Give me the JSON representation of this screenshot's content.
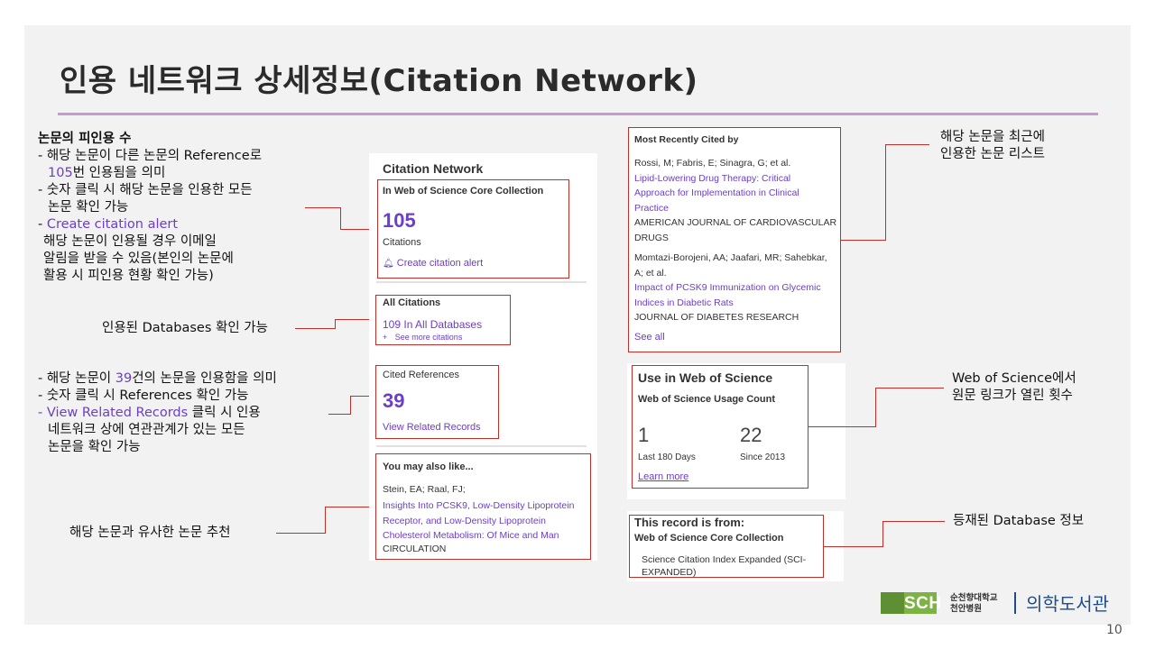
{
  "slide": {
    "title": "인용 네트워크 상세정보(Citation Network)",
    "page_number": "10"
  },
  "left_annotations": {
    "times_cited": {
      "heading": "논문의 피인용 수",
      "line1": "- 해당 논문이 다른 논문의 Reference로",
      "line2_num": "105",
      "line2_rest": "번 인용됨을 의미",
      "line3": "- 숫자 클릭 시 해당 논문을 인용한 모든",
      "line4": "논문 확인 가능",
      "line5_dash": "- ",
      "line5_link": "Create citation alert",
      "line6": "해당 논문이 인용될 경우 이메일",
      "line7": "알림을 받을 수 있음(본인의 논문에",
      "line8": "활용 시 피인용 현황 확인 가능)"
    },
    "databases": "인용된 Databases 확인 가능",
    "references": {
      "line1_a": "- 해당 논문이 ",
      "line1_num": "39",
      "line1_b": "건의 논문을 인용함을 의미",
      "line2": "- 숫자 클릭 시 References 확인 가능",
      "line3_link": "- View Related Records",
      "line3_rest": " 클릭 시 인용",
      "line4": "네트워크 상에 연관관계가 있는 모든",
      "line5": "논문을 확인 가능"
    },
    "similar": "해당 논문과 유사한 논문 추천"
  },
  "citation_network": {
    "heading": "Citation Network",
    "core_collection_label": "In Web of Science Core Collection",
    "citations_count": "105",
    "citations_label": "Citations",
    "alert_link": "Create citation alert",
    "all_citations_label": "All Citations",
    "all_databases_link": "109 In All Databases",
    "see_more": "See more citations",
    "cited_references_label": "Cited References",
    "cited_references_count": "39",
    "related_records_link": "View Related Records",
    "also_like_heading": "You may also like...",
    "also_like_authors": "Stein, EA; Raal, FJ;",
    "also_like_title": [
      "Insights Into PCSK9, Low-Density Lipoprotein",
      "Receptor, and Low-Density Lipoprotein",
      "Cholesterol Metabolism: Of Mice and Man"
    ],
    "also_like_journal": "CIRCULATION"
  },
  "recently_cited": {
    "heading": "Most Recently Cited by",
    "item1_authors": "Rossi, M; Fabris, E; Sinagra, G; et al.",
    "item1_title": [
      "Lipid-Lowering Drug Therapy: Critical",
      "Approach for Implementation in Clinical",
      "Practice"
    ],
    "item1_journal": [
      "AMERICAN JOURNAL OF CARDIOVASCULAR",
      "DRUGS"
    ],
    "item2_authors": [
      "Momtazi-Borojeni, AA; Jaafari, MR; Sahebkar,",
      "A; et al."
    ],
    "item2_title": [
      "Impact of PCSK9 Immunization on Glycemic",
      "Indices in Diabetic Rats"
    ],
    "item2_journal": "JOURNAL OF DIABETES RESEARCH",
    "see_all": "See all"
  },
  "usage": {
    "heading": "Use in Web of Science",
    "subheading": "Web of Science Usage Count",
    "count_180": "1",
    "label_180": "Last 180 Days",
    "count_2013": "22",
    "label_2013": "Since 2013",
    "learn_more": "Learn more"
  },
  "record_source": {
    "heading": "This record is from:",
    "collection": "Web of Science Core Collection",
    "index": [
      "Science Citation Index Expanded (SCI-",
      "EXPANDED)"
    ]
  },
  "right_annotations": {
    "recent_line1": "해당 논문을 최근에",
    "recent_line2": "인용한 논문 리스트",
    "usage_line1": "Web of Science에서",
    "usage_line2": "원문 링크가 열린 횟수",
    "database": "등재된 Database 정보"
  },
  "footer": {
    "logo_mark": "SCH",
    "university": "순천향대학교",
    "hospital": "천안병원",
    "library": "의학도서관"
  },
  "colors": {
    "accent_red": "#c0302b",
    "link_purple": "#6b3fc8",
    "title_rule": "#c79ad6",
    "logo_green": "#7cb342",
    "logo_blue": "#1e4d8c"
  }
}
